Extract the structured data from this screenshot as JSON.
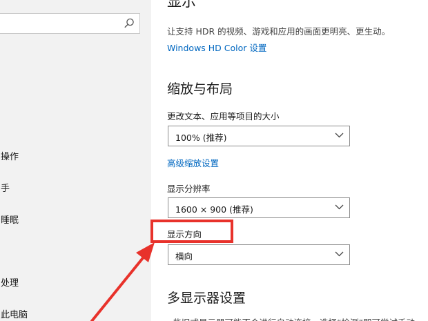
{
  "sidebar": {
    "search": {
      "placeholder": ""
    },
    "items": [
      {
        "label": "操作"
      },
      {
        "label": "手"
      },
      {
        "label": "睡眠"
      },
      {
        "label": "处理"
      },
      {
        "label": "此电脑"
      }
    ]
  },
  "content": {
    "page_title": "显示",
    "hdr_description": "让支持 HDR 的视频、游戏和应用的画面更明亮、更生动。",
    "hdr_link": "Windows HD Color 设置",
    "scale_section_title": "缩放与布局",
    "text_size_label": "更改文本、应用等项目的大小",
    "text_size_value": "100% (推荐)",
    "advanced_scaling_link": "高级缩放设置",
    "resolution_label": "显示分辨率",
    "resolution_value": "1600 × 900 (推荐)",
    "orientation_label": "显示方向",
    "orientation_value": "横向",
    "multi_display_title": "多显示器设置",
    "multi_display_desc": "一些旧式显示器可能不会进行自动连接。选择“检测”即可尝试手动"
  },
  "annotation": {
    "highlight_color": "#e8322b"
  }
}
